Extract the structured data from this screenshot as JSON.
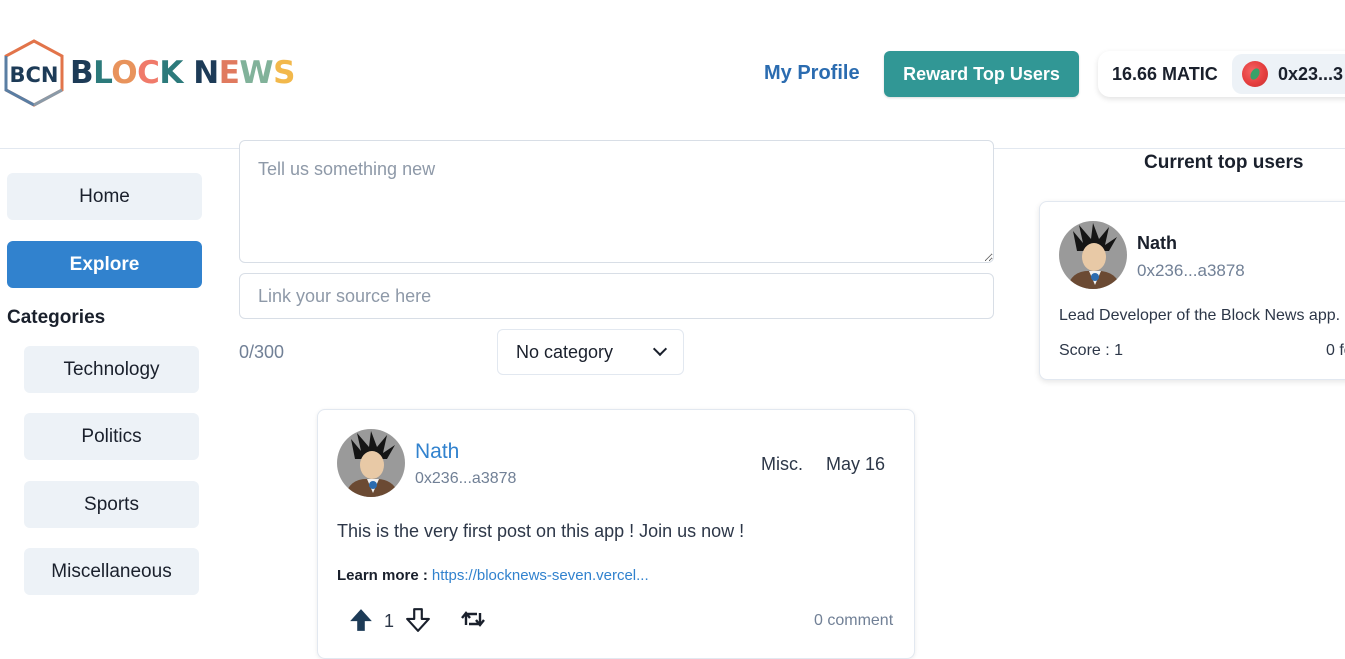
{
  "header": {
    "logo_text": "BLOCK NEWS",
    "logo_badge": "BCN",
    "my_profile": "My Profile",
    "reward_button": "Reward Top Users",
    "balance": "16.66 MATIC",
    "address": "0x23...3"
  },
  "sidebar": {
    "home": "Home",
    "explore": "Explore",
    "categories_title": "Categories",
    "categories": [
      "Technology",
      "Politics",
      "Sports",
      "Miscellaneous"
    ]
  },
  "composer": {
    "text_placeholder": "Tell us something new",
    "source_placeholder": "Link your source here",
    "counter": "0/300",
    "category_selected": "No category"
  },
  "post": {
    "author": "Nath",
    "address": "0x236...a3878",
    "category": "Misc.",
    "date": "May 16",
    "text": "This is the very first post on this app ! Join us now !",
    "learn_more_label": "Learn more :",
    "link": "https://blocknews-seven.vercel...",
    "votes": "1",
    "comments": "0 comment"
  },
  "top_users": {
    "title": "Current top users",
    "users": [
      {
        "name": "Nath",
        "address": "0x236...a3878",
        "bio": "Lead Developer of the Block News app.",
        "score": "Score : 1",
        "followers": "0 fo"
      }
    ]
  },
  "colors": {
    "accent_blue": "#3182ce",
    "teal": "#319795",
    "link_blue": "#2b6cb0"
  },
  "icons": [
    "logo-hexagon-icon",
    "wallet-avatar-icon",
    "chevron-down-icon",
    "arrow-up-icon",
    "arrow-down-icon",
    "retweet-icon"
  ]
}
